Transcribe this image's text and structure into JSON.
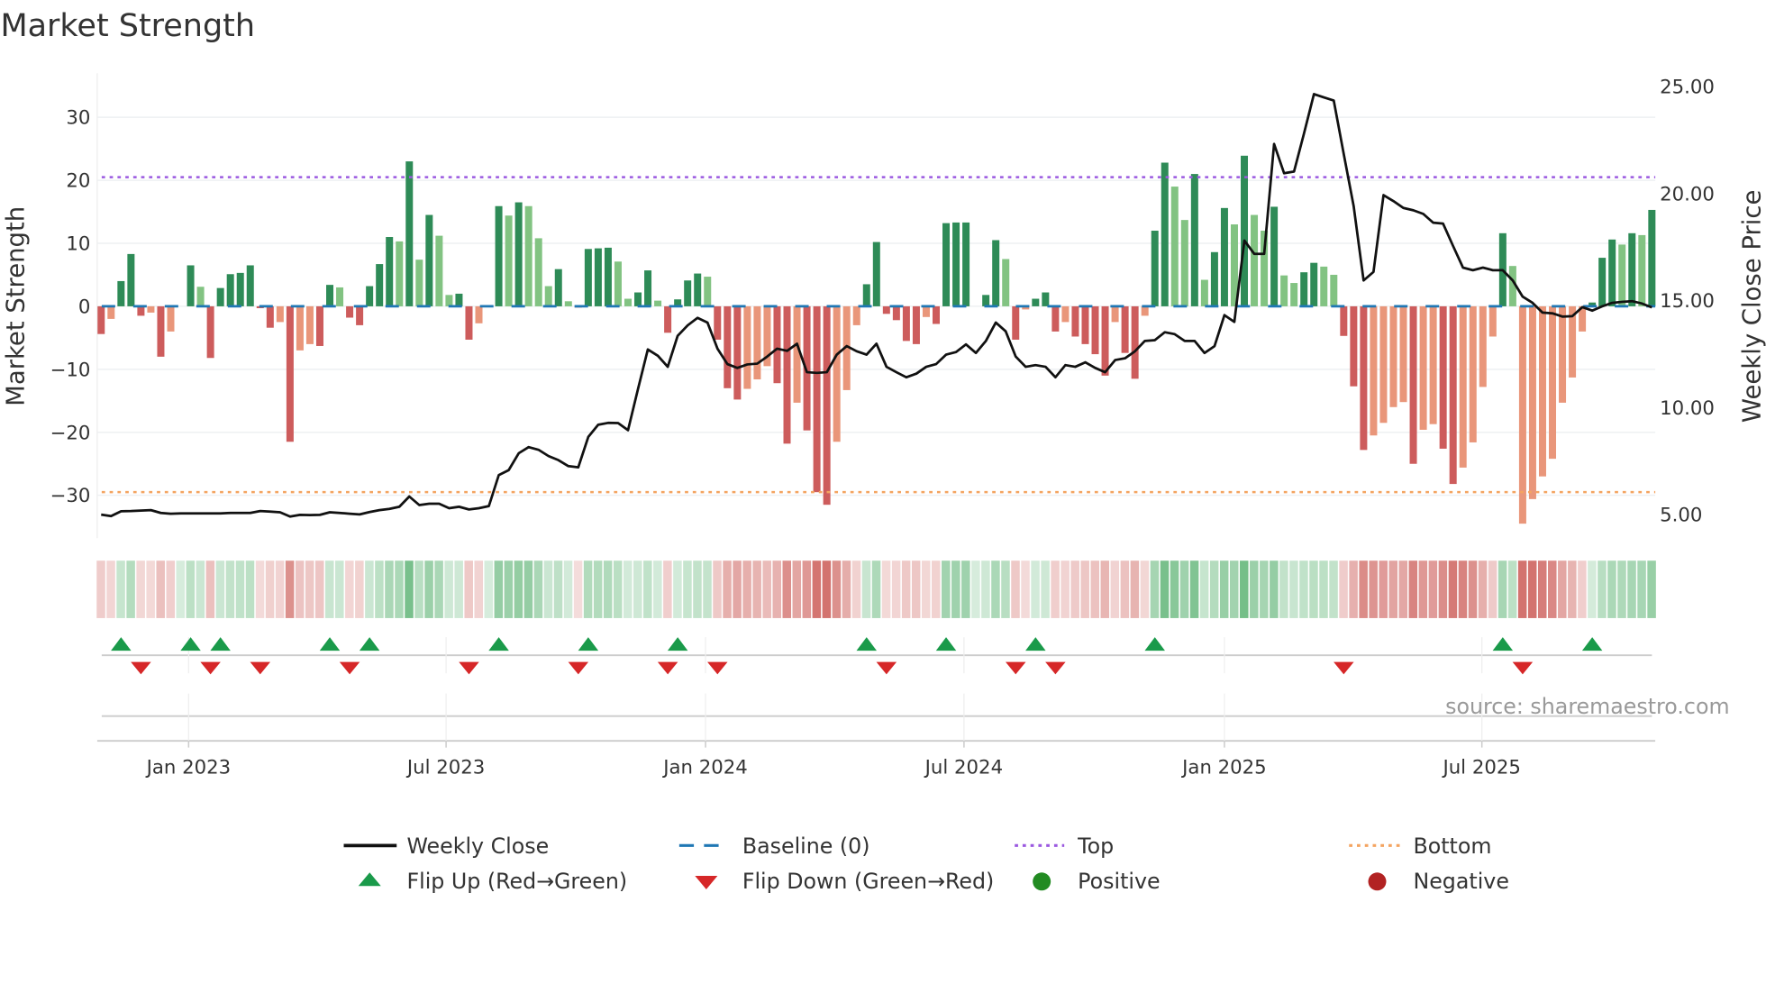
{
  "chart_data": {
    "type": "bar",
    "title": "Market Strength",
    "ylabel": "Market Strength",
    "y2label": "Weekly Close Price",
    "source": "source: sharemaestro.com",
    "ylim": [
      -36.8,
      37
    ],
    "y2lim": [
      3.84,
      25.58
    ],
    "yticks": [
      {
        "v": 30,
        "label": "30"
      },
      {
        "v": 20,
        "label": "20"
      },
      {
        "v": 10,
        "label": "10"
      },
      {
        "v": 0,
        "label": "0"
      },
      {
        "v": -10,
        "label": "−10"
      },
      {
        "v": -20,
        "label": "−20"
      },
      {
        "v": -30,
        "label": "−30"
      }
    ],
    "y2ticks": [
      {
        "v": 25,
        "label": "25.00"
      },
      {
        "v": 20,
        "label": "20.00"
      },
      {
        "v": 15,
        "label": "15.00"
      },
      {
        "v": 10,
        "label": "10.00"
      },
      {
        "v": 5,
        "label": "5.00"
      }
    ],
    "xticks": [
      {
        "week": 8.8,
        "label": "Jan 2023"
      },
      {
        "week": 34.7,
        "label": "Jul 2023"
      },
      {
        "week": 60.8,
        "label": "Jan 2024"
      },
      {
        "week": 86.8,
        "label": "Jul 2024"
      },
      {
        "week": 113,
        "label": "Jan 2025"
      },
      {
        "week": 138.9,
        "label": "Jul 2025"
      }
    ],
    "top_level": 20.5,
    "bottom_level": -29.5,
    "baseline": 0,
    "strength": [
      -4.4,
      -2,
      4,
      8.3,
      -1.5,
      -1,
      -8,
      -4,
      0,
      6.5,
      3.1,
      -8.2,
      2.9,
      5.1,
      5.3,
      6.5,
      -0.3,
      -3.4,
      -2.5,
      -21.5,
      -7,
      -6,
      -6.3,
      3.4,
      3,
      -1.8,
      -3,
      3.2,
      6.7,
      11,
      10.3,
      23,
      7.4,
      14.5,
      11.2,
      1.8,
      2,
      -5.3,
      -2.7,
      0,
      15.9,
      14.4,
      16.5,
      15.9,
      10.8,
      3.2,
      5.9,
      0.8,
      -0.2,
      9.1,
      9.2,
      9.3,
      7.1,
      1.2,
      2.2,
      5.7,
      0.9,
      -4.2,
      1.1,
      4.1,
      5.2,
      4.7,
      -5.3,
      -13,
      -14.8,
      -13.1,
      -11.6,
      -9.5,
      -12.2,
      -21.8,
      -15.3,
      -19.7,
      -29.5,
      -31.5,
      -21.5,
      -13.3,
      -3,
      3.5,
      10.2,
      -1.2,
      -2.2,
      -5.5,
      -6,
      -1.7,
      -2.8,
      13.2,
      13.3,
      13.3,
      0,
      1.8,
      10.5,
      7.5,
      -5.3,
      -0.5,
      1.2,
      2.2,
      -4,
      -2.5,
      -4.8,
      -6,
      -7.6,
      -11,
      -2.5,
      -7.4,
      -11.5,
      -1.5,
      12,
      22.8,
      19,
      13.7,
      21,
      4.2,
      8.6,
      15.6,
      13,
      23.9,
      14.5,
      12,
      15.8,
      4.9,
      3.7,
      5.4,
      6.9,
      6.3,
      5,
      -4.7,
      -12.7,
      -22.8,
      -20.5,
      -18.5,
      -16,
      -15.2,
      -25,
      -19.6,
      -18.7,
      -22.6,
      -28.2,
      -25.6,
      -21.6,
      -12.8,
      -4.8,
      11.6,
      6.4,
      -34.5,
      -30.6,
      -27,
      -24.2,
      -15.3,
      -11.3,
      -4,
      0.6,
      7.7,
      10.6,
      9.8,
      11.6,
      11.3,
      15.3
    ],
    "shade": "DLDDDLDLDDLDDDDDDDLDLLDDLDDDDDLDLDLLDDLDDLDLLLDLDDDDLLDDLDDDDLDDDLLLDDLDDDLLLDDDDDDLDDDDDDDLDLDDDLDDDDLDDLDDLLDLDDLDLLDLLDDLLDDDLLLLDLLDDLLLLDLLLLLLLLDDDLDLD",
    "weekly_close": [
      4.94,
      4.87,
      5.1,
      5.11,
      5.13,
      5.15,
      5.02,
      4.98,
      5.0,
      5.0,
      5.0,
      5.0,
      5.0,
      5.02,
      5.02,
      5.02,
      5.11,
      5.08,
      5.05,
      4.85,
      4.93,
      4.92,
      4.93,
      5.05,
      5.02,
      4.98,
      4.95,
      5.06,
      5.15,
      5.21,
      5.31,
      5.79,
      5.39,
      5.45,
      5.45,
      5.24,
      5.31,
      5.18,
      5.24,
      5.34,
      6.79,
      7.02,
      7.81,
      8.1,
      7.97,
      7.68,
      7.49,
      7.21,
      7.15,
      8.57,
      9.14,
      9.23,
      9.22,
      8.89,
      10.8,
      12.66,
      12.37,
      11.85,
      13.3,
      13.79,
      14.14,
      13.92,
      12.7,
      11.98,
      11.8,
      11.96,
      12.0,
      12.33,
      12.7,
      12.6,
      12.93,
      11.6,
      11.57,
      11.6,
      12.42,
      12.82,
      12.58,
      12.42,
      12.93,
      11.85,
      11.6,
      11.36,
      11.53,
      11.85,
      11.98,
      12.42,
      12.54,
      12.9,
      12.5,
      13.06,
      13.92,
      13.51,
      12.33,
      11.85,
      11.93,
      11.85,
      11.36,
      11.93,
      11.85,
      12.06,
      11.8,
      11.6,
      12.17,
      12.25,
      12.58,
      13.06,
      13.1,
      13.47,
      13.38,
      13.06,
      13.06,
      12.5,
      12.82,
      14.27,
      13.95,
      17.75,
      17.13,
      17.13,
      22.27,
      20.9,
      20.98,
      22.75,
      24.6,
      24.45,
      24.3,
      21.79,
      19.36,
      15.89,
      16.29,
      19.88,
      19.6,
      19.28,
      19.17,
      19.0,
      18.59,
      18.55,
      17.5,
      16.49,
      16.37,
      16.49,
      16.37,
      16.37,
      15.89,
      15.13,
      14.84,
      14.39,
      14.35,
      14.2,
      14.22,
      14.64,
      14.48,
      14.68,
      14.84,
      14.89,
      14.92,
      14.81,
      14.63
    ],
    "flip_up_weeks": [
      2,
      9,
      12,
      23,
      27,
      40,
      49,
      58,
      77,
      85,
      94,
      106,
      141,
      150
    ],
    "flip_down_weeks": [
      4,
      11,
      16,
      25,
      37,
      48,
      57,
      62,
      79,
      92,
      96,
      125,
      143
    ],
    "legend": {
      "placement": "bottom",
      "items": [
        {
          "key": "weekly_close",
          "label": "Weekly Close"
        },
        {
          "key": "baseline",
          "label": "Baseline (0)"
        },
        {
          "key": "top",
          "label": "Top"
        },
        {
          "key": "bottom",
          "label": "Bottom"
        },
        {
          "key": "flip_up",
          "label": "Flip Up (Red→Green)"
        },
        {
          "key": "flip_down",
          "label": "Flip Down (Green→Red)"
        },
        {
          "key": "positive",
          "label": "Positive"
        },
        {
          "key": "negative",
          "label": "Negative"
        }
      ]
    },
    "colors": {
      "green_dark": "#2e8b57",
      "green_light": "#82c382",
      "red_dark": "#cd5c5c",
      "red_light": "#e9967a",
      "line": "#111111",
      "baseline": "#1f77b4",
      "top": "#9b59e0",
      "bottom": "#f4a460",
      "flip_up": "#1a9a4a",
      "flip_down": "#d62728",
      "positive": "#228b22",
      "negative": "#b22222"
    }
  }
}
